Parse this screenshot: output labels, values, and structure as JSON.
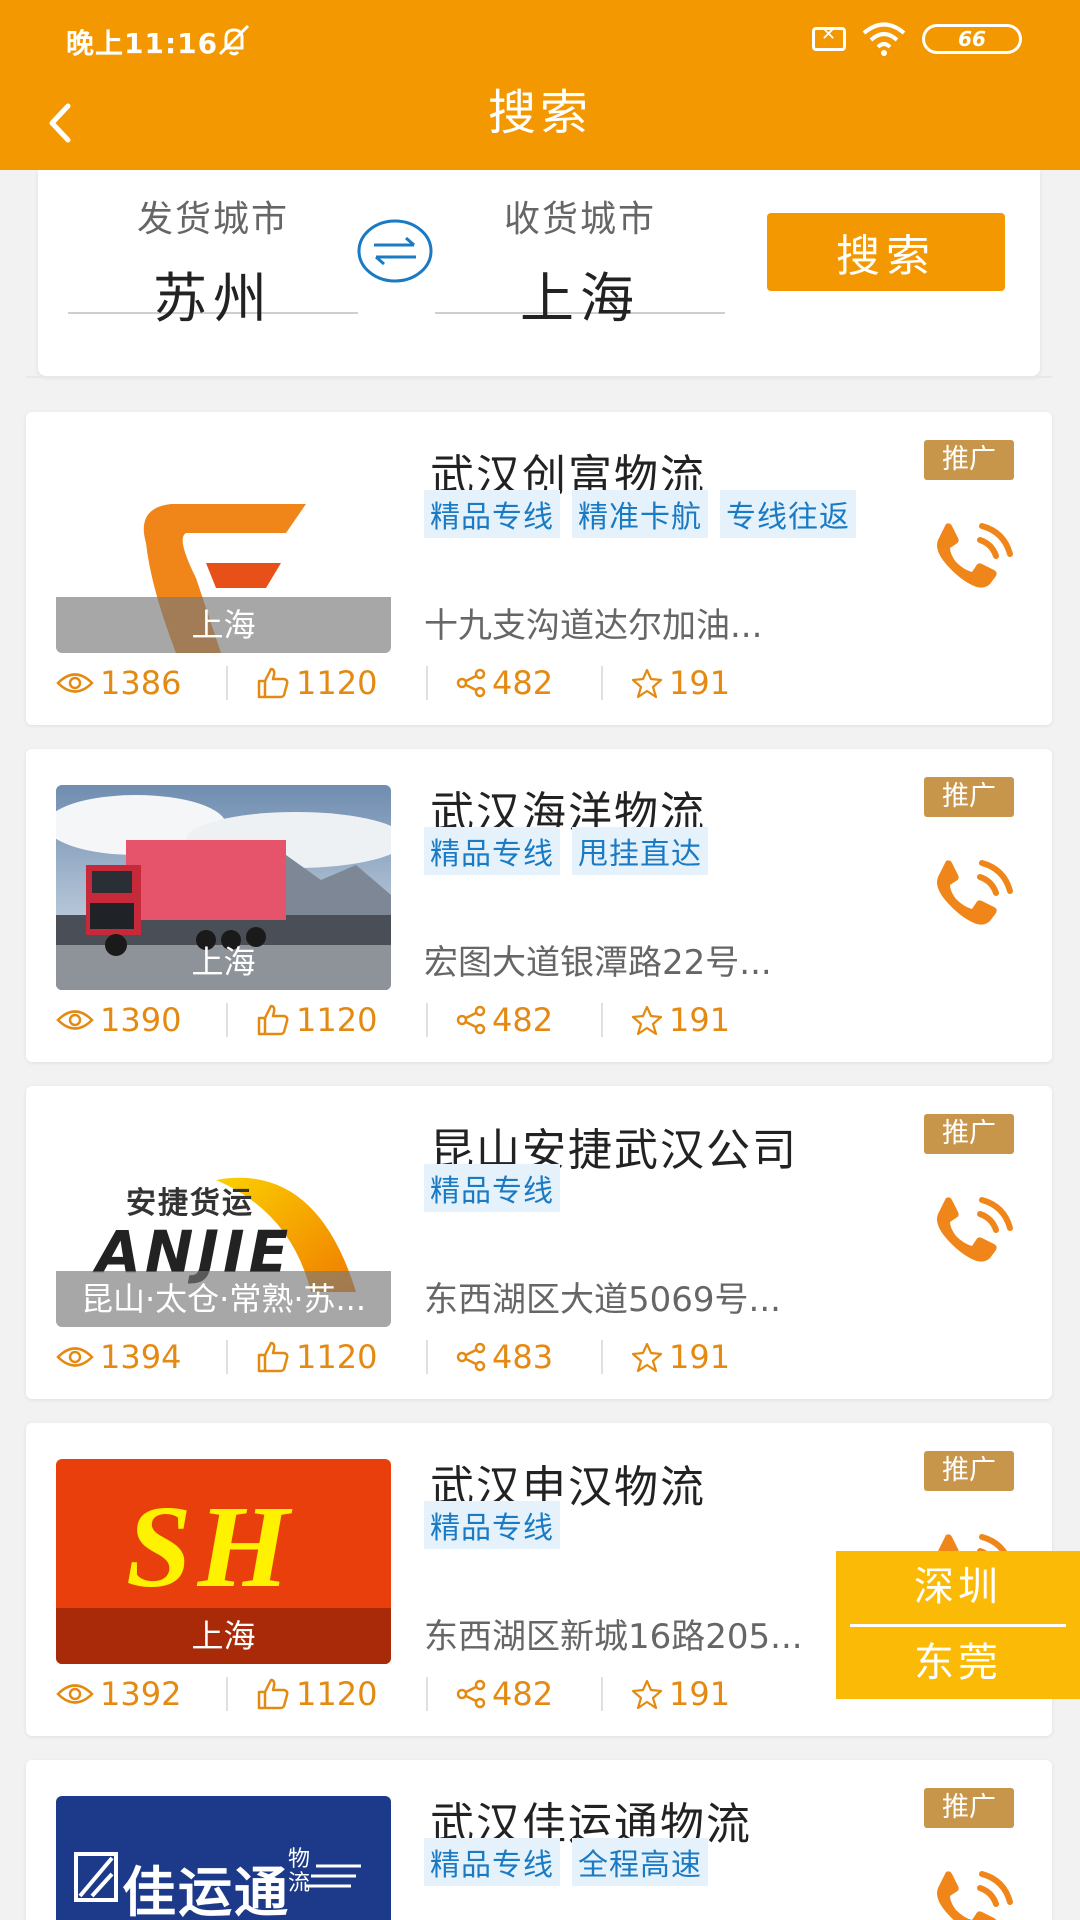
{
  "status_bar": {
    "time": "晚上11:16",
    "battery": "66"
  },
  "header": {
    "title": "搜索"
  },
  "search": {
    "from_label": "发货城市",
    "from_city": "苏州",
    "to_label": "收货城市",
    "to_city": "上海",
    "button_label": "搜索"
  },
  "listings": [
    {
      "name": "武汉创富物流",
      "badge": "推广",
      "tags": [
        "精品专线",
        "精准卡航",
        "专线往返"
      ],
      "location": "上海",
      "address": "十九支沟道达尔加油...",
      "views": "1386",
      "likes": "1120",
      "shares": "482",
      "favorites": "191"
    },
    {
      "name": "武汉海洋物流",
      "badge": "推广",
      "tags": [
        "精品专线",
        "甩挂直达"
      ],
      "location": "上海",
      "address": "宏图大道银潭路22号...",
      "views": "1390",
      "likes": "1120",
      "shares": "482",
      "favorites": "191"
    },
    {
      "name": "昆山安捷武汉公司",
      "badge": "推广",
      "tags": [
        "精品专线"
      ],
      "location": "昆山·太仓·常熟·苏...",
      "logo_text": "安捷货运",
      "logo_text_en": "ANJIE",
      "address": "东西湖区大道5069号...",
      "views": "1394",
      "likes": "1120",
      "shares": "483",
      "favorites": "191"
    },
    {
      "name": "武汉申汉物流",
      "badge": "推广",
      "tags": [
        "精品专线"
      ],
      "location": "上海",
      "logo_text": "SH",
      "address": "东西湖区新城16路205...",
      "views": "1392",
      "likes": "1120",
      "shares": "482",
      "favorites": "191"
    },
    {
      "name": "武汉佳运通物流",
      "badge": "推广",
      "tags": [
        "精品专线",
        "全程高速"
      ],
      "logo_text": "佳运通",
      "logo_sub": "物流"
    }
  ],
  "float_tabs": [
    "深圳",
    "东莞"
  ],
  "colors": {
    "brand_orange": "#f39800",
    "stat_orange": "#e48a12",
    "tag_blue": "#1a7bc4",
    "badge_gold": "#c8964a",
    "float_yellow": "#fbba06"
  },
  "icons": [
    "back-arrow",
    "mute-bell",
    "sim",
    "wifi",
    "battery",
    "swap",
    "phone",
    "eye",
    "thumbs-up",
    "share",
    "star"
  ]
}
